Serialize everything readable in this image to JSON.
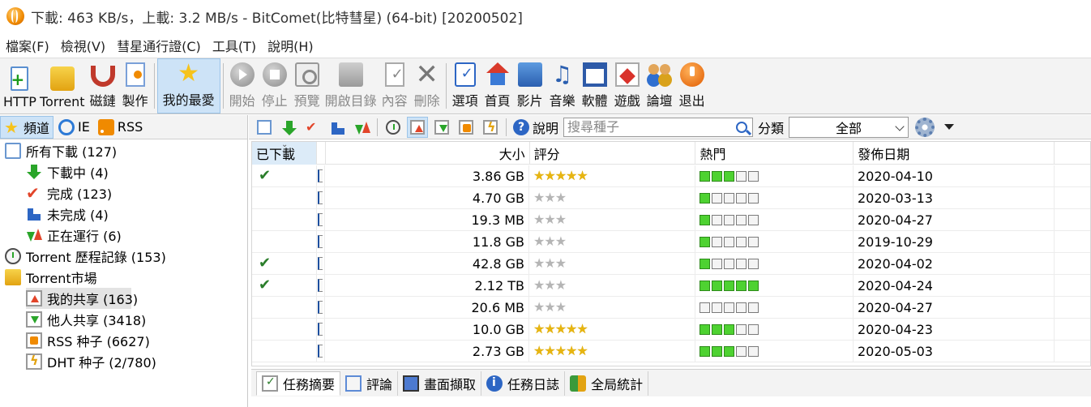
{
  "window": {
    "title": "下載: 463 KB/s，上載: 3.2 MB/s - BitComet(比特彗星) (64-bit) [20200502]"
  },
  "menu": [
    "檔案(F)",
    "檢視(V)",
    "彗星通行證(C)",
    "工具(T)",
    "說明(H)"
  ],
  "toolbar": {
    "http": "HTTP",
    "torrent": "Torrent",
    "magnet": "磁鏈",
    "make": "製作",
    "favorites": "我的最愛",
    "start": "開始",
    "stop": "停止",
    "preview": "預覽",
    "open_dir": "開啟目錄",
    "content": "內容",
    "delete": "刪除",
    "options": "選項",
    "home": "首頁",
    "movies": "影片",
    "music": "音樂",
    "software": "軟體",
    "games": "遊戲",
    "forum": "論壇",
    "exit": "退出"
  },
  "left_tabs": [
    "頻道",
    "IE",
    "RSS"
  ],
  "tree": {
    "all_downloads": "所有下載 (127)",
    "downloading": "下載中 (4)",
    "completed": "完成 (123)",
    "incomplete": "未完成 (4)",
    "running": "正在運行 (6)",
    "history": "Torrent 歷程記錄 (153)",
    "market": "Torrent市場",
    "my_share": "我的共享 (163)",
    "others_share": "他人共享 (3418)",
    "rss_seeds": "RSS 种子 (6627)",
    "dht_seeds": "DHT 种子 (2/780)"
  },
  "search": {
    "help_label": "說明",
    "placeholder": "搜尋種子",
    "category_label": "分類",
    "category_value": "全部"
  },
  "columns": {
    "downloaded": "已下載",
    "size": "大小",
    "rating": "評分",
    "popularity": "熱門",
    "date": "發佈日期"
  },
  "rows": [
    {
      "downloaded": true,
      "size": "3.86 GB",
      "stars": 5,
      "heat": 3,
      "date": "2020-04-10"
    },
    {
      "downloaded": false,
      "size": "4.70 GB",
      "stars": 3,
      "heat": 1,
      "date": "2020-03-13"
    },
    {
      "downloaded": false,
      "size": "19.3 MB",
      "stars": 3,
      "heat": 1,
      "date": "2020-04-27"
    },
    {
      "downloaded": false,
      "size": "11.8 GB",
      "stars": 3,
      "heat": 1,
      "date": "2019-10-29"
    },
    {
      "downloaded": true,
      "size": "42.8 GB",
      "stars": 3,
      "heat": 1,
      "date": "2020-04-02"
    },
    {
      "downloaded": true,
      "size": "2.12 TB",
      "stars": 3,
      "heat": 5,
      "date": "2020-04-24"
    },
    {
      "downloaded": false,
      "size": "20.6 MB",
      "stars": 3,
      "heat": 0,
      "date": "2020-04-27"
    },
    {
      "downloaded": false,
      "size": "10.0 GB",
      "stars": 5,
      "heat": 3,
      "date": "2020-04-23"
    },
    {
      "downloaded": false,
      "size": "2.73 GB",
      "stars": 5,
      "heat": 3,
      "date": "2020-05-03"
    }
  ],
  "bottom_tabs": [
    "任務摘要",
    "評論",
    "畫面擷取",
    "任務日誌",
    "全局統計"
  ],
  "colors": {
    "accent": "#cde3f7",
    "heat_on": "#4ed231",
    "star_on": "#e7b511"
  }
}
